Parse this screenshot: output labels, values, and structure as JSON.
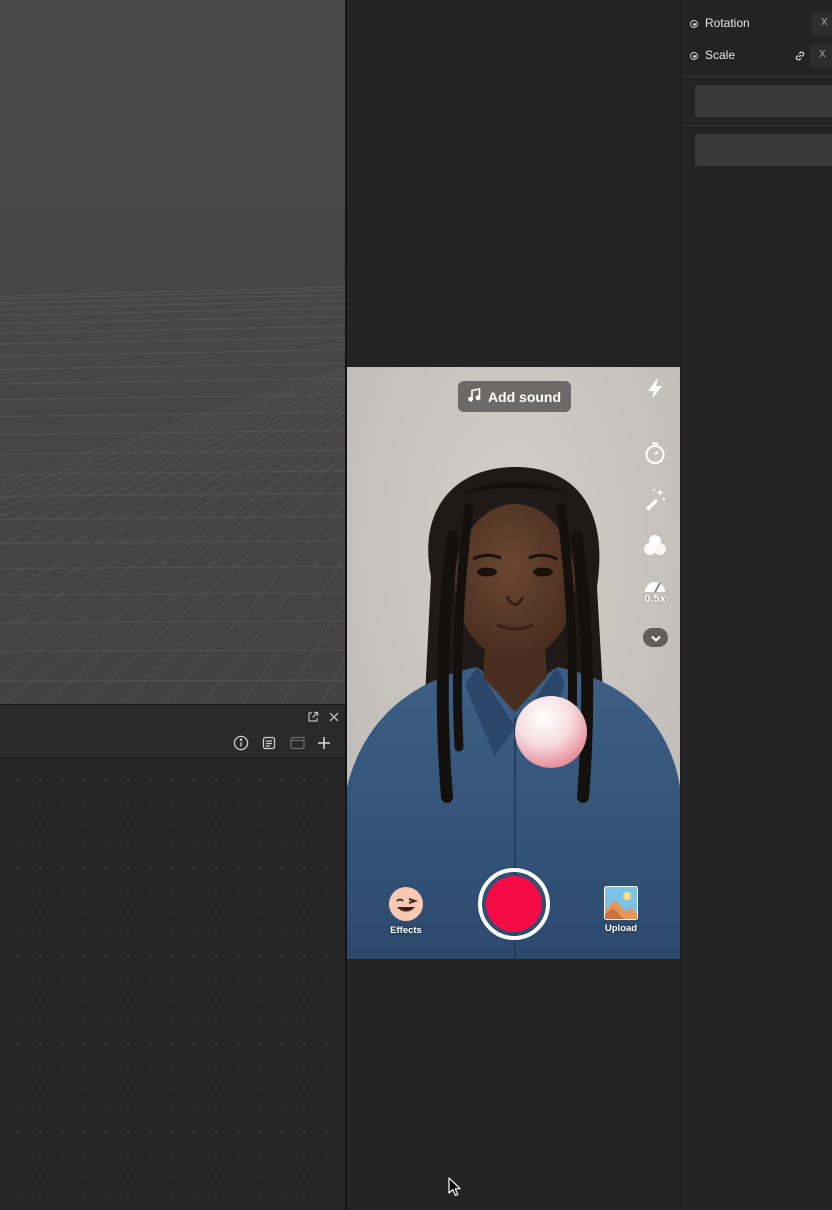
{
  "preview": {
    "add_sound_label": "Add sound",
    "speed_label": "0.5x",
    "effects_label": "Effects",
    "upload_label": "Upload",
    "record_color": "#f50c47"
  },
  "inspector": {
    "rotation_label": "Rotation",
    "scale_label": "Scale",
    "axis_x_label": "X"
  },
  "icons": {
    "popout": "popout-icon",
    "close": "close-icon",
    "info": "info-icon",
    "list": "list-icon",
    "window": "window-icon",
    "add": "plus-icon",
    "flash": "flash-icon",
    "timer": "timer-icon",
    "beauty": "magic-wand-icon",
    "filters": "filters-icon",
    "speed": "speed-icon",
    "more": "chevron-down-icon",
    "link": "link-icon"
  }
}
